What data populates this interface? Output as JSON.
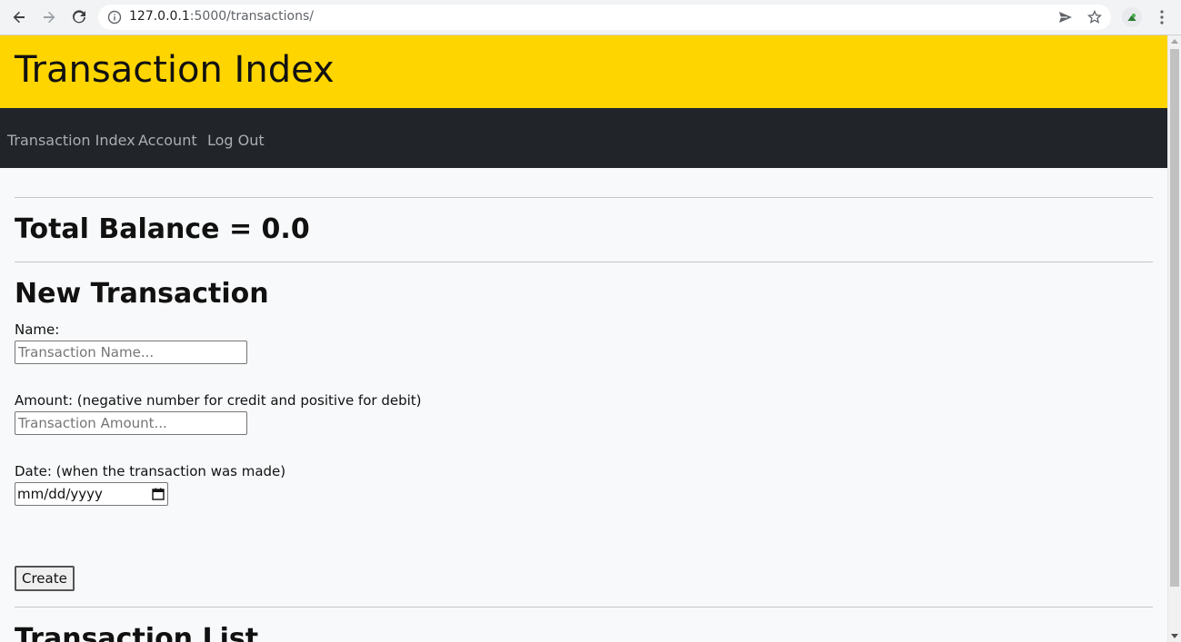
{
  "browser": {
    "url_host": "127.0.0.1",
    "url_path": ":5000/transactions/",
    "icons": {
      "back": "arrow-left-icon",
      "forward": "arrow-right-icon",
      "reload": "reload-icon",
      "info": "info-icon",
      "send": "send-icon",
      "bookmark": "star-icon",
      "extension": "extension-icon",
      "menu": "kebab-menu-icon"
    }
  },
  "header": {
    "title": "Transaction Index",
    "background": "#ffd500"
  },
  "nav": {
    "background": "#212529",
    "links": [
      "Transaction Index",
      "Account",
      "Log Out"
    ]
  },
  "balance": {
    "text": "Total Balance = 0.0"
  },
  "form": {
    "heading": "New Transaction",
    "name_label": "Name:",
    "name_placeholder": "Transaction Name...",
    "amount_label": "Amount: (negative number for credit and positive for debit)",
    "amount_placeholder": "Transaction Amount...",
    "date_label": "Date: (when the transaction was made)",
    "date_value": "mm/dd/yyyy",
    "submit_label": "Create"
  },
  "list": {
    "heading": "Transaction List"
  }
}
